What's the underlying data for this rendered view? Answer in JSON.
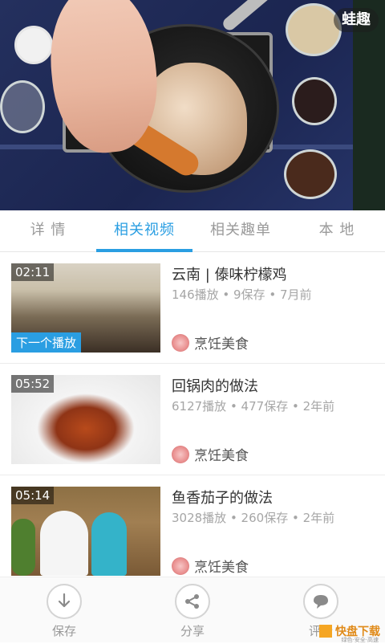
{
  "video": {
    "brand": "蛙趣"
  },
  "tabs": [
    {
      "label": "详 情",
      "active": false
    },
    {
      "label": "相关视频",
      "active": true
    },
    {
      "label": "相关趣单",
      "active": false
    },
    {
      "label": "本 地",
      "active": false
    }
  ],
  "items": [
    {
      "duration": "02:11",
      "badge": "下一个播放",
      "title": "云南 | 傣味柠檬鸡",
      "meta": "146播放 • 9保存 • 7月前",
      "author": "烹饪美食"
    },
    {
      "duration": "05:52",
      "title": "回锅肉的做法",
      "meta": "6127播放 • 477保存 • 2年前",
      "author": "烹饪美食"
    },
    {
      "duration": "05:14",
      "title": "鱼香茄子的做法",
      "meta": "3028播放 • 260保存 • 2年前",
      "author": "烹饪美食"
    }
  ],
  "bottom": {
    "save": "保存",
    "share": "分享",
    "comment": "评论",
    "watermark": {
      "name": "快盘下载",
      "tagline": "绿色·安全·高速"
    }
  },
  "colors": {
    "accent": "#2a9ee2"
  },
  "icons": {
    "save": "download-arrow-icon",
    "share": "share-icon",
    "comment": "chat-bubble-icon"
  }
}
